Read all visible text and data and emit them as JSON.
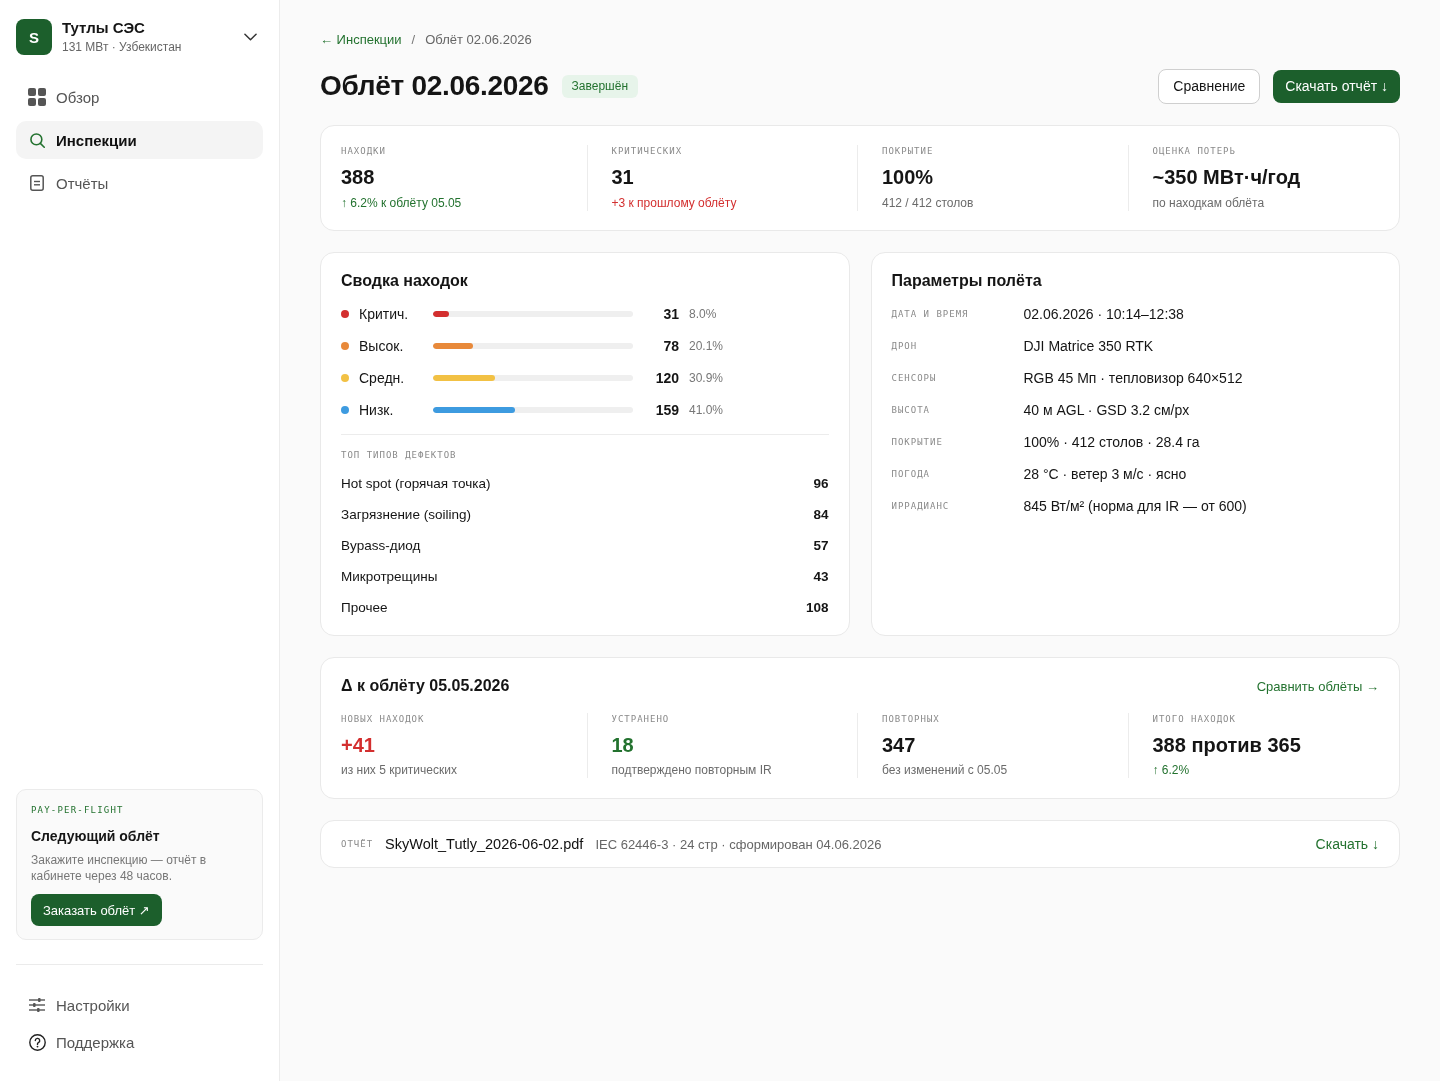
{
  "sidebar": {
    "org": {
      "avatar": "S",
      "name": "Тутлы СЭС",
      "details": "131 МВт · Узбекистан"
    },
    "nav": [
      {
        "label": "Обзор",
        "selected": false
      },
      {
        "label": "Инспекции",
        "selected": true
      },
      {
        "label": "Отчёты",
        "selected": false
      }
    ],
    "promo": {
      "tag": "PAY-PER-FLIGHT",
      "title": "Следующий облёт",
      "text": "Закажите инспекцию — отчёт в кабинете через 48 часов.",
      "button": "Заказать облёт ↗"
    },
    "footer_nav": [
      {
        "label": "Настройки"
      },
      {
        "label": "Поддержка"
      }
    ]
  },
  "breadcrumb": {
    "back": "← Инспекции",
    "separator": "/",
    "current": "Облёт 02.06.2026"
  },
  "header": {
    "title": "Облёт 02.06.2026",
    "status": "Завершён",
    "buttons": [
      {
        "label": "Сравнение",
        "kind": "secondary"
      },
      {
        "label": "Скачать отчёт ↓",
        "kind": "primary"
      }
    ]
  },
  "kpis": [
    {
      "label": "НАХОДКИ",
      "value": {
        "text": "388",
        "color": "#151515"
      },
      "note": {
        "text": "↑ 6.2% к облёту 05.05",
        "color": "#23722f"
      }
    },
    {
      "label": "КРИТИЧЕСКИХ",
      "value": {
        "text": "31",
        "color": "#151515"
      },
      "note": {
        "text": "+3 к прошлому облёту",
        "color": "#d32f2f"
      }
    },
    {
      "label": "ПОКРЫТИЕ",
      "value": {
        "text": "100%",
        "color": "#151515"
      },
      "note": {
        "text": "412 / 412 столов",
        "color": "#6b6b6b"
      }
    },
    {
      "label": "ОЦЕНКА ПОТЕРЬ",
      "value": {
        "text": "~350 МВт·ч/год",
        "color": "#151515"
      },
      "note": {
        "text": "по находкам облёта",
        "color": "#6b6b6b"
      }
    }
  ],
  "findings_summary": {
    "title": "Сводка находок",
    "severities": [
      {
        "label": "Критич.",
        "color": "#d32f2f",
        "level": 0.08,
        "count": "31",
        "share": "8.0%"
      },
      {
        "label": "Высок.",
        "color": "#e8893a",
        "level": 0.201,
        "count": "78",
        "share": "20.1%"
      },
      {
        "label": "Средн.",
        "color": "#f2c144",
        "level": 0.309,
        "count": "120",
        "share": "30.9%"
      },
      {
        "label": "Низк.",
        "color": "#3d9be0",
        "level": 0.41,
        "count": "159",
        "share": "41.0%"
      }
    ],
    "top_title": "ТОП ТИПОВ ДЕФЕКТОВ",
    "top_types": [
      {
        "name": "Hot spot (горячая точка)",
        "count": "96"
      },
      {
        "name": "Загрязнение (soiling)",
        "count": "84"
      },
      {
        "name": "Bypass-диод",
        "count": "57"
      },
      {
        "name": "Микротрещины",
        "count": "43"
      },
      {
        "name": "Прочее",
        "count": "108"
      }
    ]
  },
  "flight_params": {
    "title": "Параметры полёта",
    "rows": [
      {
        "label": "ДАТА И ВРЕМЯ",
        "value": "02.06.2026 · 10:14–12:38"
      },
      {
        "label": "ДРОН",
        "value": "DJI Matrice 350 RTK"
      },
      {
        "label": "СЕНСОРЫ",
        "value": "RGB 45 Мп · тепловизор 640×512"
      },
      {
        "label": "ВЫСОТА",
        "value": "40 м AGL · GSD 3.2 см/px"
      },
      {
        "label": "ПОКРЫТИЕ",
        "value": "100% · 412 столов · 28.4 га"
      },
      {
        "label": "ПОГОДА",
        "value": "28 °C · ветер 3 м/с · ясно"
      },
      {
        "label": "ИРРАДИАНС",
        "value": "845 Вт/м² (норма для IR — от 600)"
      }
    ]
  },
  "delta": {
    "title": "Δ к облёту 05.05.2026",
    "link": "Сравнить облёты →",
    "stats": [
      {
        "label": "НОВЫХ НАХОДОК",
        "value": {
          "text": "+41",
          "color": "#d32f2f"
        },
        "note": {
          "text": "из них 5 критических",
          "color": "#6b6b6b"
        }
      },
      {
        "label": "УСТРАНЕНО",
        "value": {
          "text": "18",
          "color": "#23722f"
        },
        "note": {
          "text": "подтверждено повторным IR",
          "color": "#6b6b6b"
        }
      },
      {
        "label": "ПОВТОРНЫХ",
        "value": {
          "text": "347",
          "color": "#151515"
        },
        "note": {
          "text": "без изменений с 05.05",
          "color": "#6b6b6b"
        }
      },
      {
        "label": "ИТОГО НАХОДОК",
        "value": {
          "text": "388 против 365",
          "color": "#151515"
        },
        "note": {
          "text": "↑ 6.2%",
          "color": "#23722f"
        }
      }
    ]
  },
  "report": {
    "label": "ОТЧЁТ",
    "filename": "SkyWolt_Tutly_2026-06-02.pdf",
    "meta": "IEC 62446-3 · 24 стр · сформирован 04.06.2026",
    "link": "Скачать ↓"
  }
}
